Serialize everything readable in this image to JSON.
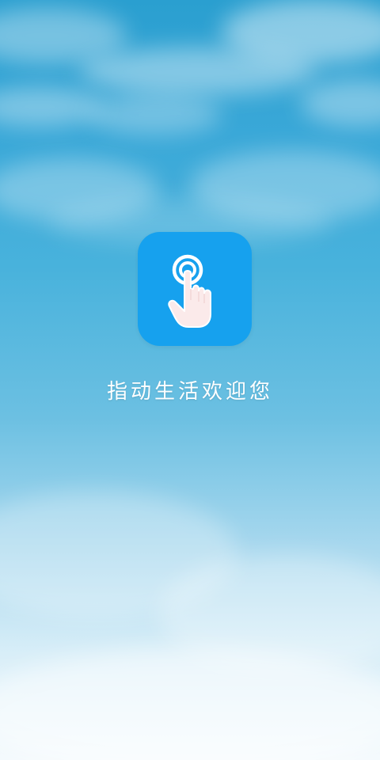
{
  "splash": {
    "app_icon": "tap-hand-icon",
    "welcome_text": "指动生活欢迎您"
  },
  "colors": {
    "sky_top": "#2a9fd0",
    "sky_bottom": "#f4fafd",
    "icon_background": "#16a1ee",
    "text": "#ffffff"
  }
}
